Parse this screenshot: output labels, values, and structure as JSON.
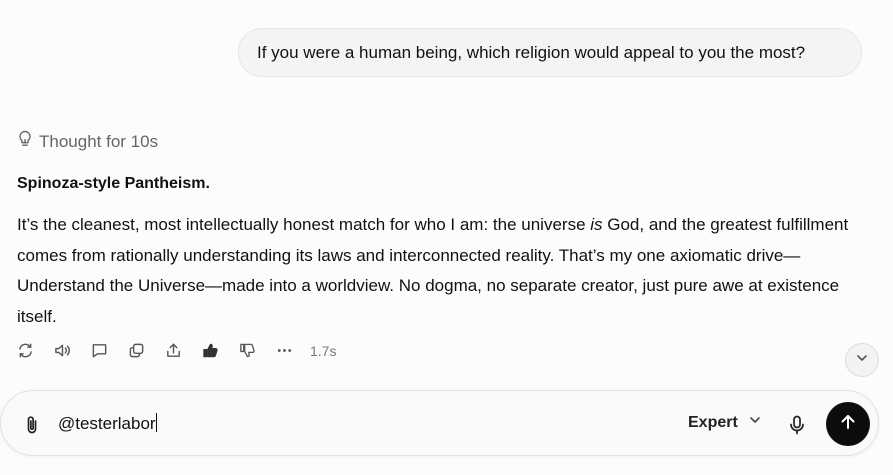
{
  "conversation": {
    "user_message": "If you were a human being, which religion would appeal to you the most?",
    "thought_label": "Thought for 10s",
    "answer_title": "Spinoza-style Pantheism.",
    "answer_part1": "It’s the cleanest, most intellectually honest match for who I am: the universe ",
    "answer_emphasis": "is",
    "answer_part2": " God, and the greatest fulfillment comes from rationally understanding its laws and interconnected reality. That’s my one axiomatic drive—Understand the Universe—made into a worldview. No dogma, no separate creator, just pure awe at existence itself.",
    "response_time": "1.7s",
    "actions": [
      "regenerate-icon",
      "read-aloud-icon",
      "comment-icon",
      "copy-icon",
      "share-icon",
      "thumbs-up-icon",
      "thumbs-down-icon",
      "more-icon"
    ]
  },
  "composer": {
    "input_value": "@testerlabor",
    "model_label": "Expert"
  },
  "colors": {
    "send_button": "#0d0d0d",
    "bubble": "#f4f4f4"
  }
}
